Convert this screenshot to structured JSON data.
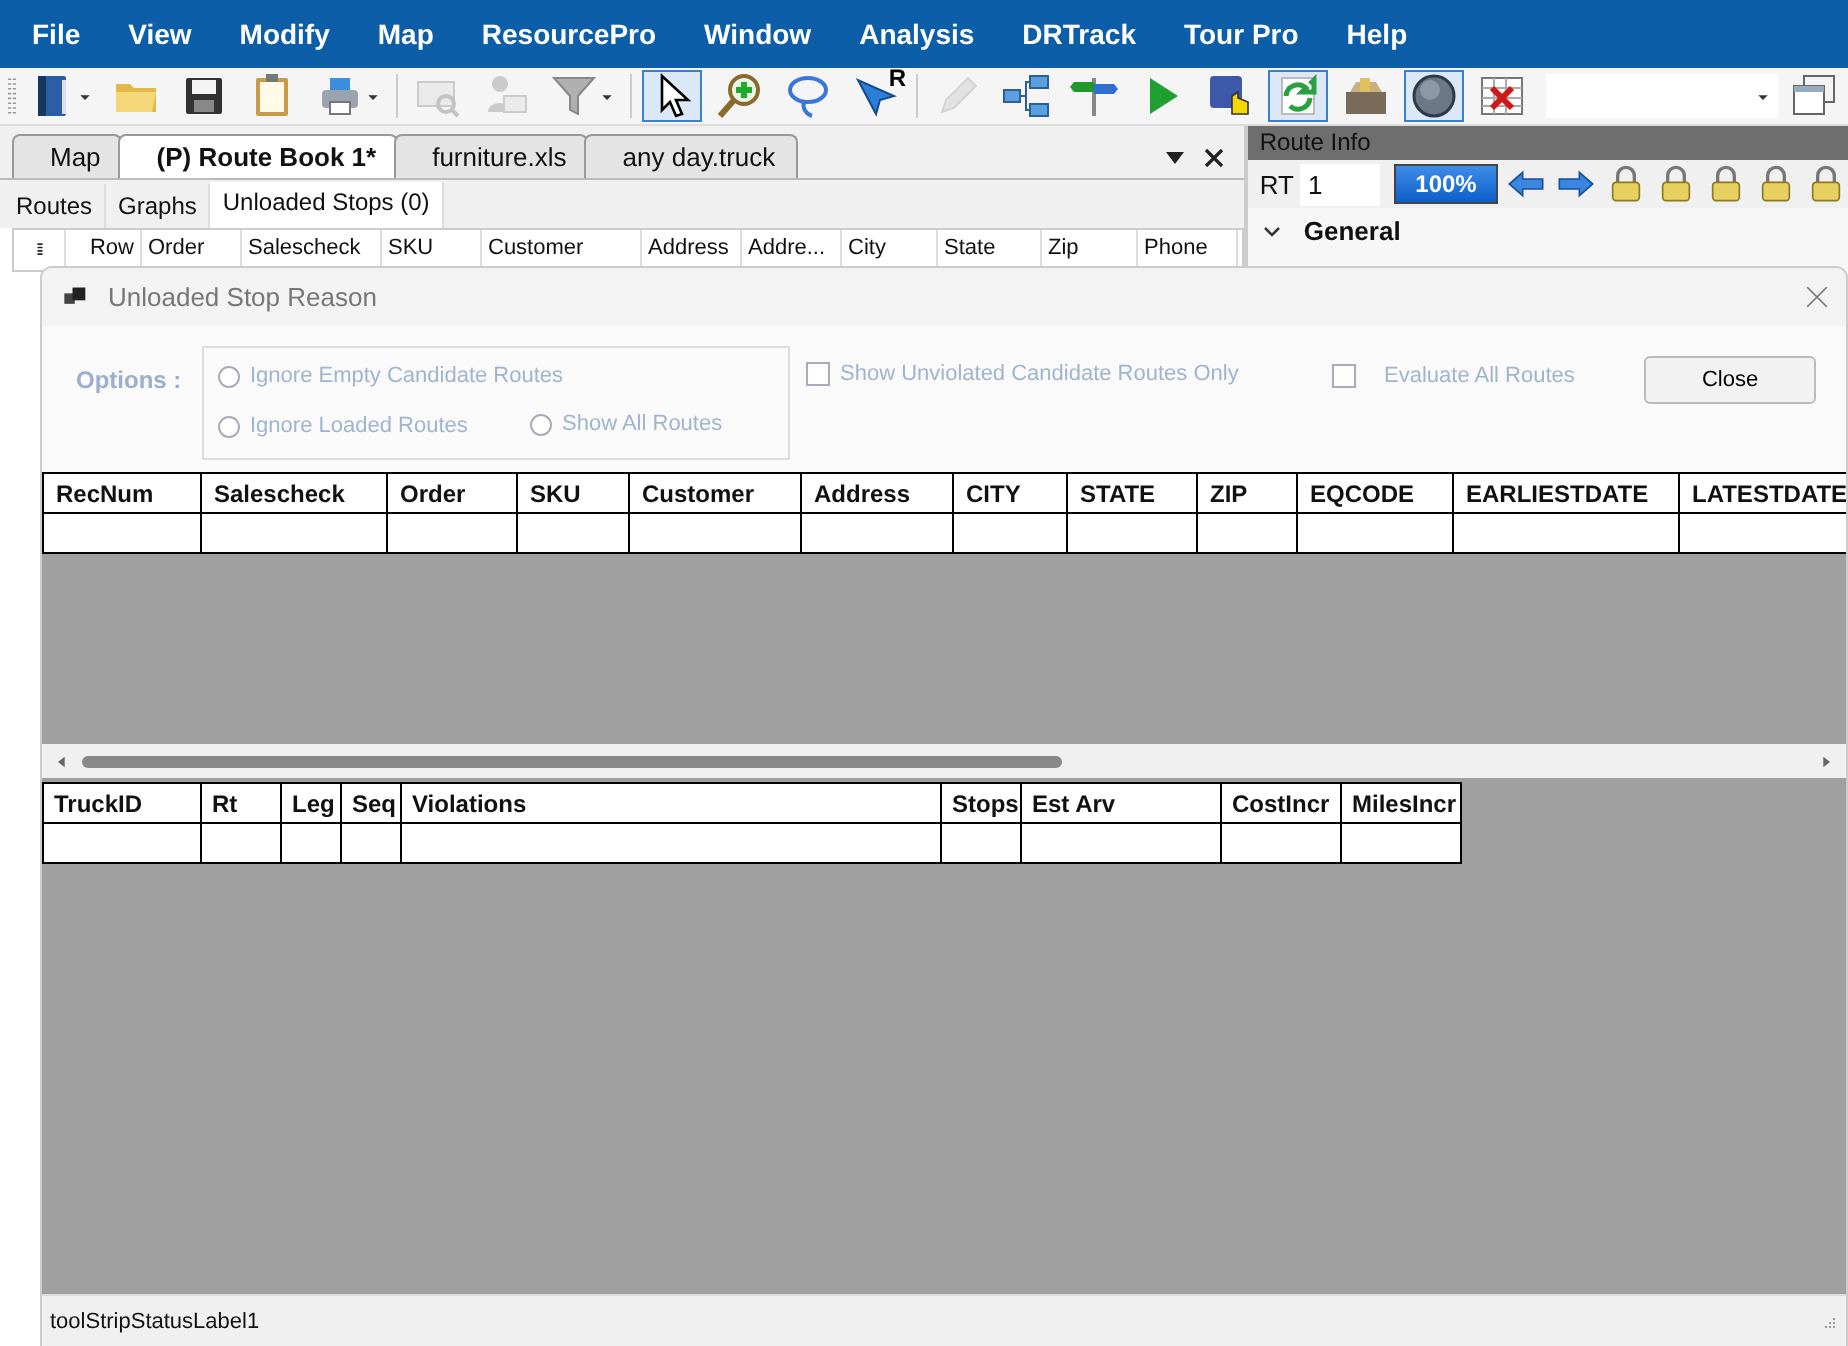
{
  "menu": [
    "File",
    "View",
    "Modify",
    "Map",
    "ResourcePro",
    "Window",
    "Analysis",
    "DRTrack",
    "Tour Pro",
    "Help"
  ],
  "toolbar": [
    {
      "kind": "book",
      "dropdown": true,
      "pressed": false,
      "disabled": false
    },
    {
      "kind": "folder",
      "dropdown": false,
      "pressed": false,
      "disabled": false
    },
    {
      "kind": "save",
      "dropdown": false,
      "pressed": false,
      "disabled": false
    },
    {
      "kind": "clipboard",
      "dropdown": false,
      "pressed": false,
      "disabled": false
    },
    {
      "kind": "printer",
      "dropdown": true,
      "pressed": false,
      "disabled": false
    },
    {
      "kind": "sep"
    },
    {
      "kind": "mailsearch",
      "dropdown": false,
      "pressed": false,
      "disabled": true
    },
    {
      "kind": "personmail",
      "dropdown": false,
      "pressed": false,
      "disabled": true
    },
    {
      "kind": "funnel",
      "dropdown": true,
      "pressed": false,
      "disabled": false
    },
    {
      "kind": "sep"
    },
    {
      "kind": "pointer",
      "dropdown": false,
      "pressed": true,
      "disabled": false
    },
    {
      "kind": "zoomin",
      "dropdown": false,
      "pressed": false,
      "disabled": false
    },
    {
      "kind": "lasso",
      "dropdown": false,
      "pressed": false,
      "disabled": false
    },
    {
      "kind": "pointerletter",
      "label": "R",
      "dropdown": false,
      "pressed": false,
      "disabled": false
    },
    {
      "kind": "sep"
    },
    {
      "kind": "pencil",
      "dropdown": false,
      "pressed": false,
      "disabled": true
    },
    {
      "kind": "tree",
      "dropdown": false,
      "pressed": false,
      "disabled": false
    },
    {
      "kind": "signpost",
      "dropdown": false,
      "pressed": false,
      "disabled": false
    },
    {
      "kind": "play",
      "dropdown": false,
      "pressed": false,
      "disabled": false
    },
    {
      "kind": "windowhand",
      "dropdown": false,
      "pressed": false,
      "disabled": false
    },
    {
      "kind": "refresh",
      "dropdown": false,
      "pressed": true,
      "disabled": false
    },
    {
      "kind": "toolbox",
      "dropdown": false,
      "pressed": false,
      "disabled": false
    },
    {
      "kind": "circle",
      "dropdown": false,
      "pressed": true,
      "disabled": false
    },
    {
      "kind": "calendarx",
      "dropdown": false,
      "pressed": false,
      "disabled": false
    },
    {
      "kind": "combo"
    },
    {
      "kind": "windows",
      "dropdown": false,
      "pressed": false,
      "disabled": false
    }
  ],
  "doc_tabs": [
    {
      "label": "Map",
      "selected": false
    },
    {
      "label": "(P) Route Book 1*",
      "selected": true
    },
    {
      "label": "furniture.xls",
      "selected": false
    },
    {
      "label": "any day.truck",
      "selected": false
    }
  ],
  "sub_tabs": [
    {
      "label": "Routes",
      "selected": false
    },
    {
      "label": "Graphs",
      "selected": false
    },
    {
      "label": "Unloaded Stops (0)",
      "selected": true
    }
  ],
  "routes_grid": {
    "columns": [
      "Row",
      "Order",
      "Salescheck",
      "SKU",
      "Customer",
      "Address",
      "Addre...",
      "City",
      "State",
      "Zip",
      "Phone"
    ]
  },
  "route_info": {
    "title": "Route Info",
    "rt_label": "RT",
    "rt_value": "1",
    "progress": {
      "level": 1,
      "reading": "100%"
    },
    "section": {
      "title": "General",
      "expanded": true
    }
  },
  "dialog": {
    "title": "Unloaded Stop Reason",
    "options_label": "Options :",
    "radios": [
      {
        "label": "Ignore Empty Candidate Routes",
        "selected": false,
        "disabled": true
      },
      {
        "label": "Ignore Loaded Routes",
        "selected": false,
        "disabled": true
      },
      {
        "label": "Show All Routes",
        "selected": false,
        "disabled": true
      }
    ],
    "checkboxes": [
      {
        "label": "Show Unviolated Candidate Routes Only",
        "checked": false,
        "disabled": true
      },
      {
        "label": "Evaluate All Routes",
        "checked": false,
        "disabled": true
      }
    ],
    "close_button": "Close",
    "stops_table": {
      "columns": [
        "RecNum",
        "Salescheck",
        "Order",
        "SKU",
        "Customer",
        "Address",
        "CITY",
        "STATE",
        "ZIP",
        "EQCODE",
        "EARLIESTDATE",
        "LATESTDATE"
      ]
    },
    "routes_table": {
      "columns": [
        "TruckID",
        "Rt",
        "Leg",
        "Seq",
        "Violations",
        "Stops",
        "Est Arv",
        "CostIncr",
        "MilesIncr"
      ]
    },
    "status_bar": "toolStripStatusLabel1"
  }
}
